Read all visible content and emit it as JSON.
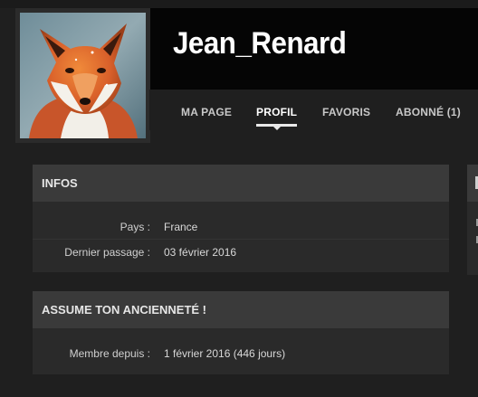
{
  "profile": {
    "username": "Jean_Renard"
  },
  "nav": {
    "tabs": [
      {
        "label": "MA PAGE",
        "active": false
      },
      {
        "label": "PROFIL",
        "active": true
      },
      {
        "label": "FAVORIS",
        "active": false
      },
      {
        "label": "ABONNÉ (1)",
        "active": false
      }
    ]
  },
  "infos": {
    "title": "INFOS",
    "rows": [
      {
        "label": "Pays :",
        "value": "France"
      },
      {
        "label": "Dernier passage :",
        "value": "03 février 2016"
      }
    ]
  },
  "anciennete": {
    "title": "ASSUME TON ANCIENNETÉ !",
    "rows": [
      {
        "label": "Membre depuis :",
        "value": "1 février 2016 (446 jours)"
      }
    ]
  },
  "colors": {
    "background": "#1f1f1f",
    "banner": "#050505",
    "panel": "#2a2a2a",
    "panel_header": "#3a3a3a",
    "text": "#dcdcdc"
  }
}
